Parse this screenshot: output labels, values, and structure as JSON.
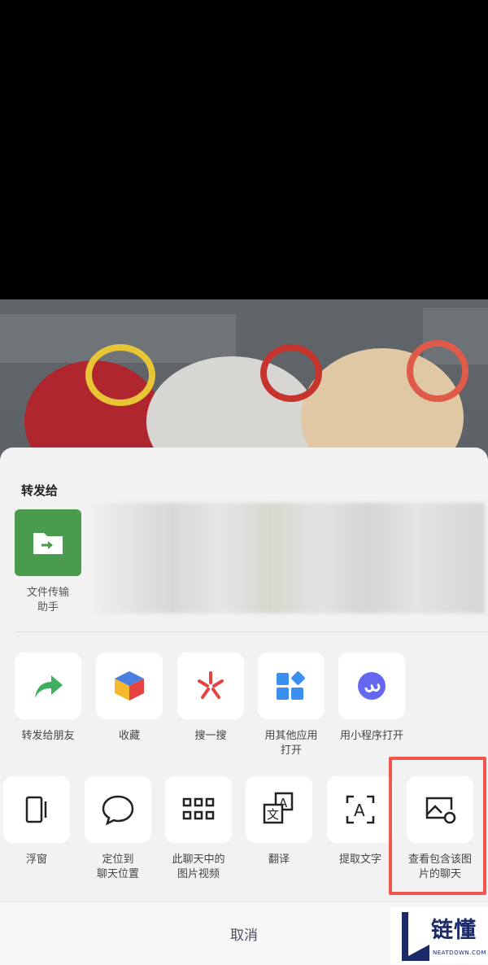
{
  "forward_section": {
    "title": "转发给",
    "contact": {
      "label": "文件传输\n助手",
      "icon": "file-transfer-icon"
    }
  },
  "actions_row1": [
    {
      "label": "转发给朋友",
      "icon": "share-arrow-icon",
      "color": "#3db160"
    },
    {
      "label": "收藏",
      "icon": "favorite-cube-icon",
      "color": "#4a7fe0"
    },
    {
      "label": "搜一搜",
      "icon": "search-star-icon",
      "color": "#e64340"
    },
    {
      "label": "用其他应用\n打开",
      "icon": "other-apps-icon",
      "color": "#3b8ff0"
    },
    {
      "label": "用小程序打开",
      "icon": "mini-program-icon",
      "color": "#6467f0"
    }
  ],
  "actions_row2": [
    {
      "label": "浮窗",
      "icon": "floating-window-icon"
    },
    {
      "label": "定位到\n聊天位置",
      "icon": "chat-bubble-icon"
    },
    {
      "label": "此聊天中的\n图片视频",
      "icon": "grid-icon"
    },
    {
      "label": "翻译",
      "icon": "translate-icon"
    },
    {
      "label": "提取文字",
      "icon": "extract-text-icon"
    },
    {
      "label": "查看包含该图\n片的聊天",
      "icon": "image-chat-icon"
    }
  ],
  "cancel_label": "取消",
  "watermark": {
    "name": "链懂",
    "sub": "NEATDOWN.COM"
  },
  "highlight_color": "#f0584f"
}
